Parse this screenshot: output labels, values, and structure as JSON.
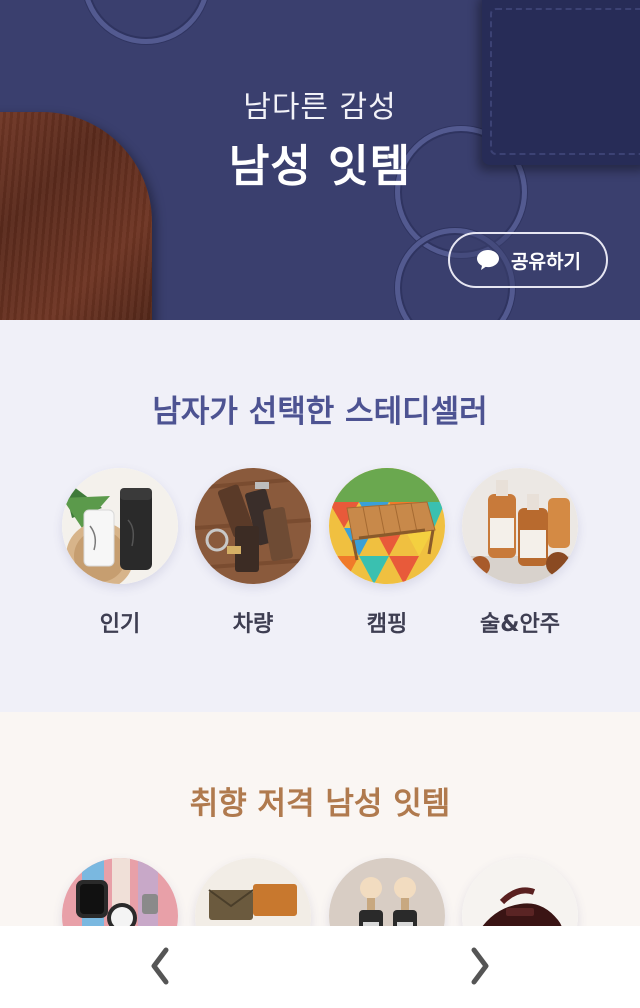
{
  "hero": {
    "subtitle": "남다른 감성",
    "title": "남성 잇템",
    "share_label": "공유하기"
  },
  "section_steady": {
    "title": "남자가 선택한 스테디셀러",
    "categories": [
      {
        "label": "인기"
      },
      {
        "label": "차량"
      },
      {
        "label": "캠핑"
      },
      {
        "label": "술&안주"
      }
    ]
  },
  "section_taste": {
    "title": "취향 저격 남성 잇템"
  },
  "nav": {
    "prev_icon": "chevron-left-icon",
    "next_icon": "chevron-right-icon"
  },
  "colors": {
    "hero_bg": "#3a3f6e",
    "section1_bg": "#f0f0f8",
    "section1_title": "#4d5392",
    "section2_bg": "#faf6f3",
    "section2_title": "#b07a4e"
  }
}
